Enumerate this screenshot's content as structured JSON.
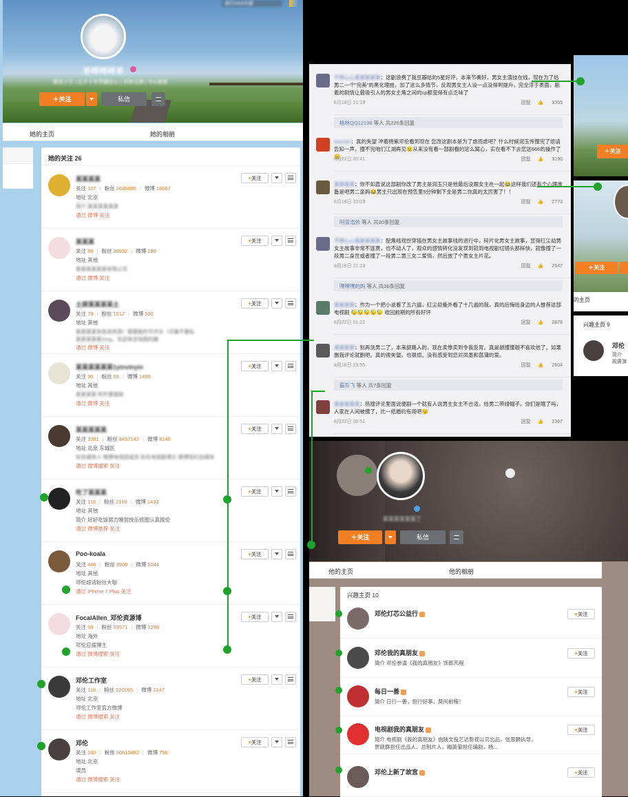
{
  "left": {
    "top_note": "进行AAA内容",
    "display_name": "羊咩咩咩羊",
    "tagline": "翼音小生 | 扛大千世界翻在心 | 各种玉牌 | 尔lo谢谢",
    "follow_btn": "关注",
    "msg_btn": "私信",
    "nav": {
      "home": "她的主页",
      "album": "她的相册"
    },
    "follow_title": "她的关注",
    "follow_count": "26",
    "users": [
      {
        "name": "某某某某",
        "l1": [
          "关注",
          "107",
          "粉丝",
          "2635880",
          "微博",
          "16067"
        ],
        "l2": "地址 北京",
        "l3": "简介 某某某某某某",
        "l4": "通过 微博 关注",
        "av": "#e0b030"
      },
      {
        "name": "某某某",
        "l1": [
          "关注",
          "89",
          "粉丝",
          "39932",
          "微博",
          "188"
        ],
        "l2": "地址 其他",
        "l3": "某某某某某某有限公司",
        "l4": "通过 微博 关注",
        "av": "#f3dde0"
      },
      {
        "name": "土拨某某某某土",
        "l1": [
          "关注",
          "79",
          "粉丝",
          "1512",
          "微博",
          "590"
        ],
        "l2": "地址 其他",
        "l3": "某某某某享高清资源！需要剧的可评论（尽量不要私",
        "l3b": "某某某某某Xing，欢迎来咨询我的糖",
        "l4": "通过 微博 关注",
        "av": "#5a4a5a"
      },
      {
        "name": "某某某某某某1yinvinyin",
        "l1": [
          "关注",
          "90",
          "粉丝",
          "69",
          "微博",
          "1499"
        ],
        "l2": "地址 其他",
        "l3": "某某某某 附件要提助",
        "l4": "通过 微博 关注",
        "av": "#e8e4d4"
      },
      {
        "name": "某某某某某",
        "l1": [
          "关注",
          "1091",
          "粉丝",
          "8457142",
          "微博",
          "8145"
        ],
        "l2": "地址 北京 东城区",
        "l3": "知名媒体人 微博电视团成员 知名电视剧博主 微博签约自媒体",
        "l4": "通过 微博搜索 关注",
        "av": "#4a3a30"
      },
      {
        "name": "吃了某某某",
        "l1": [
          "关注",
          "118",
          "粉丝",
          "2169",
          "微博",
          "1433"
        ],
        "l2": "地址 其他",
        "l3": "简介 好好吃饭努力睡觉快乐修图认真搞伦",
        "l4": "通过 微博推荐 关注",
        "av": "#222222"
      },
      {
        "name": "Poo-koala",
        "l1": [
          "关注",
          "446",
          "粉丝",
          "3909",
          "微博",
          "5044"
        ],
        "l2": "地址 其他",
        "l3": "邓伦超话粉丝大咖",
        "l4": "通过 iPhone 7 Plus 关注",
        "av": "#7a5a3a"
      },
      {
        "name": "FocalAllen_邓伦资源博",
        "l1": [
          "关注",
          "59",
          "粉丝",
          "33571",
          "微博",
          "2299"
        ],
        "l2": "地址 海外",
        "l3": "邓伦应援博主",
        "l4": "通过 微博搜索 关注",
        "av": "#f4dce0"
      },
      {
        "name": "邓伦工作室",
        "l1": [
          "关注",
          "118",
          "粉丝",
          "520095",
          "微博",
          "2147"
        ],
        "l2": "地址 北京",
        "l3": "邓伦工作室官方微博",
        "l4": "通过 微博搜索 关注",
        "av": "#3a3a3a"
      },
      {
        "name": "邓伦",
        "l1": [
          "关注",
          "160",
          "粉丝",
          "30610482",
          "微博",
          "756"
        ],
        "l2": "地址 北京",
        "l3": "演员",
        "l4": "通过 微博搜索 关注",
        "av": "#4a4040"
      }
    ]
  },
  "comments": {
    "items": [
      {
        "user": "不想心心某某某某某",
        "text": "：这剧浪费了我豆瓣给的5星好评，本来节奏好，男女主演技在线，现在为了给男二一个\"完美\"的黑化理由，加了这么多情节，反观男女主人设一点没得到提升，完全浮于表面，剧着的剧情让最吸引人的男女主角之间的cp都变得有点乏味了",
        "date": "8月18日 21:19",
        "likes": "3355",
        "av": "#6a6a8a"
      },
      {
        "user": "格林QQ12138",
        "more": "等人 共225条回复"
      },
      {
        "user": "lutuoan",
        "text": "：真的失望 冲着杨紫邓伦看到现在 您改这剧本是为了虐而虐吧？什么时候润玉传撞完了烦请告知一声，撞不完咱们江湖再见😟从来没有看一部剧看的这么窝心，实在看不下去您这666的操作了😟",
        "date": "8月22日 00:41",
        "likes": "3190",
        "av": "#d04020"
      },
      {
        "user": "某某某某",
        "text": "：你不如直说这部剧你改了男主是润玉只是他最后没跟女主在一起😂这样我们还有个心理准备是吧男二亲妈😂男主只出现在预告里5分钟剩下全是男二你真的太厉害了！！",
        "date": "8月18日 22:03",
        "likes": "2773",
        "av": "#6a5a40"
      },
      {
        "user": "阿蓝浩依",
        "more": "等人 共30条回复"
      },
      {
        "user": "不想心心某某某某某",
        "text": "：配角线戏份穿插在男女主故事线的进行中，碎片化男女主故事，显得红尘劫男女主故事非常不连贯，也不动人了，观众的感情转化没发现到就到电视剧切镜头那样快，就像撞了一段男二身世或者撞了一段男二男三女二爱情，然后放了个男女主片花。",
        "date": "8月18日 21:23",
        "likes": "2547",
        "av": "#6a6a8a"
      },
      {
        "user": "嘿嘿嘿的妈",
        "more": "等人 共36条回复"
      },
      {
        "user": "某某某某",
        "text": "：作为一个把小说看了五六遍，红尘劫番外看了十几遍的我，真的后悔给身边的人推荐这部电视剧 😓😓😓😓😓 收回前期的所有好评",
        "date": "8月22日 01:22",
        "likes": "2878",
        "av": "#5a7a6a"
      },
      {
        "user": "某某某某",
        "text": "：别再洗男二了，本来挺路人的，现在卖惨卖到令我反胃。真是越撞撞越不喜欢他了。如果删我评论就删吧。真的很失望。也很烦。没有感受到您对凤墨和菖蒲的爱。",
        "date": "8月18日 23:55",
        "likes": "2604",
        "av": "#5a5a5a"
      },
      {
        "user": "霸灰飞",
        "more": "等人 共7条回复"
      },
      {
        "user": "某某某某某",
        "text": "：热搜评论里面说便剧一个就有人说男主女主不合适，给男二带绿帽子。你们是瞎了吗，人家在人间被撞了，比一纸婚约有用吧😟",
        "date": "8月22日 00:51",
        "likes": "2367",
        "av": "#804040"
      },
      {
        "user": "沙小某某某",
        "text": "：编剧能不能把红尘劫男主两辈都已经把江山社稷和继承人都安排妥了这个逻辑写顺？不带光洗白男二，却把男主写成吊尾恋爱脑的吧？",
        "date": "8月18日 22:13",
        "likes": "2127",
        "av": "#6a6a8a"
      }
    ],
    "reply": "回复"
  },
  "right": {
    "follow": "关注",
    "home_label": "的主页",
    "interest_label": "兴趣主页 9",
    "user_name": "邓伦",
    "user_desc1": "简介",
    "user_desc2": "视男演"
  },
  "bottom": {
    "sub_name": "某某某某某某丁",
    "follow_btn": "关注",
    "msg_btn": "私信",
    "nav": {
      "home": "他的主页",
      "album": "他的相册"
    },
    "interest_title": "兴趣主页",
    "interest_count": "10",
    "items": [
      {
        "name": "邓伦灯芯公益行",
        "desc": "",
        "av": "#7a6a6a"
      },
      {
        "name": "邓伦我的真朋友",
        "desc": "简介 邓伦参演《我的真朋友》饰郎芃程",
        "av": "#4a4a4a"
      },
      {
        "name": "每日一善",
        "desc": "简介 日行一善，但行好事，莫问前程！",
        "av": "#c03030"
      },
      {
        "name": "电视剧我的真朋友",
        "desc": "简介 电视剧《我的真朋友》由陕文投艺达影视公司出品，张思麟执导，贾跃群担任出品人、总制片人，梅英菊担任编剧，杨...",
        "av": "#e03030"
      },
      {
        "name": "邓伦上新了故宫",
        "desc": "",
        "av": "#6a5a5a"
      }
    ],
    "follow_small": "关注"
  }
}
